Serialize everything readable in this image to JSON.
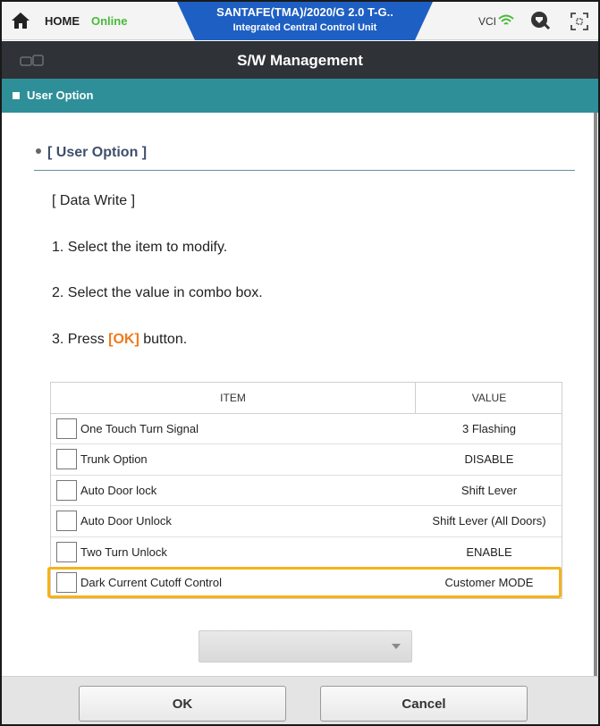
{
  "topbar": {
    "home_label": "HOME",
    "status": "Online",
    "vehicle_title": "SANTAFE(TMA)/2020/G 2.0 T-G..",
    "vehicle_subtitle": "Integrated Central Control Unit",
    "vci_label": "VCI",
    "icons": [
      "home-icon",
      "wifi-icon",
      "tool-icon",
      "fullscreen-icon"
    ]
  },
  "titlebar": {
    "title": "S/W Management",
    "icon": "car-icon"
  },
  "section": {
    "title": "User Option"
  },
  "content": {
    "heading": "[ User Option ]",
    "data_write": "[ Data Write ]",
    "step1": "1. Select the item to modify.",
    "step2": "2. Select the value in combo box.",
    "step3_prefix": "3. Press ",
    "step3_ok": "[OK]",
    "step3_suffix": " button."
  },
  "table": {
    "columns": [
      "ITEM",
      "VALUE"
    ],
    "rows": [
      {
        "item": "One Touch Turn Signal",
        "value": "3 Flashing"
      },
      {
        "item": "Trunk Option",
        "value": "DISABLE"
      },
      {
        "item": "Auto Door lock",
        "value": "Shift Lever"
      },
      {
        "item": "Auto Door Unlock",
        "value": "Shift Lever (All Doors)"
      },
      {
        "item": "Two Turn Unlock",
        "value": "ENABLE"
      },
      {
        "item": "Dark Current Cutoff Control",
        "value": "Customer MODE"
      }
    ],
    "highlighted_row_index": 5
  },
  "dropdown": {
    "selected": ""
  },
  "buttons": {
    "ok": "OK",
    "cancel": "Cancel"
  },
  "colors": {
    "accent_blue": "#1e5fc4",
    "title_bar": "#2f3237",
    "section_bar": "#2f8f98",
    "online_green": "#49b93a",
    "ok_highlight": "#f07a1b",
    "row_highlight": "#f6b21a"
  }
}
